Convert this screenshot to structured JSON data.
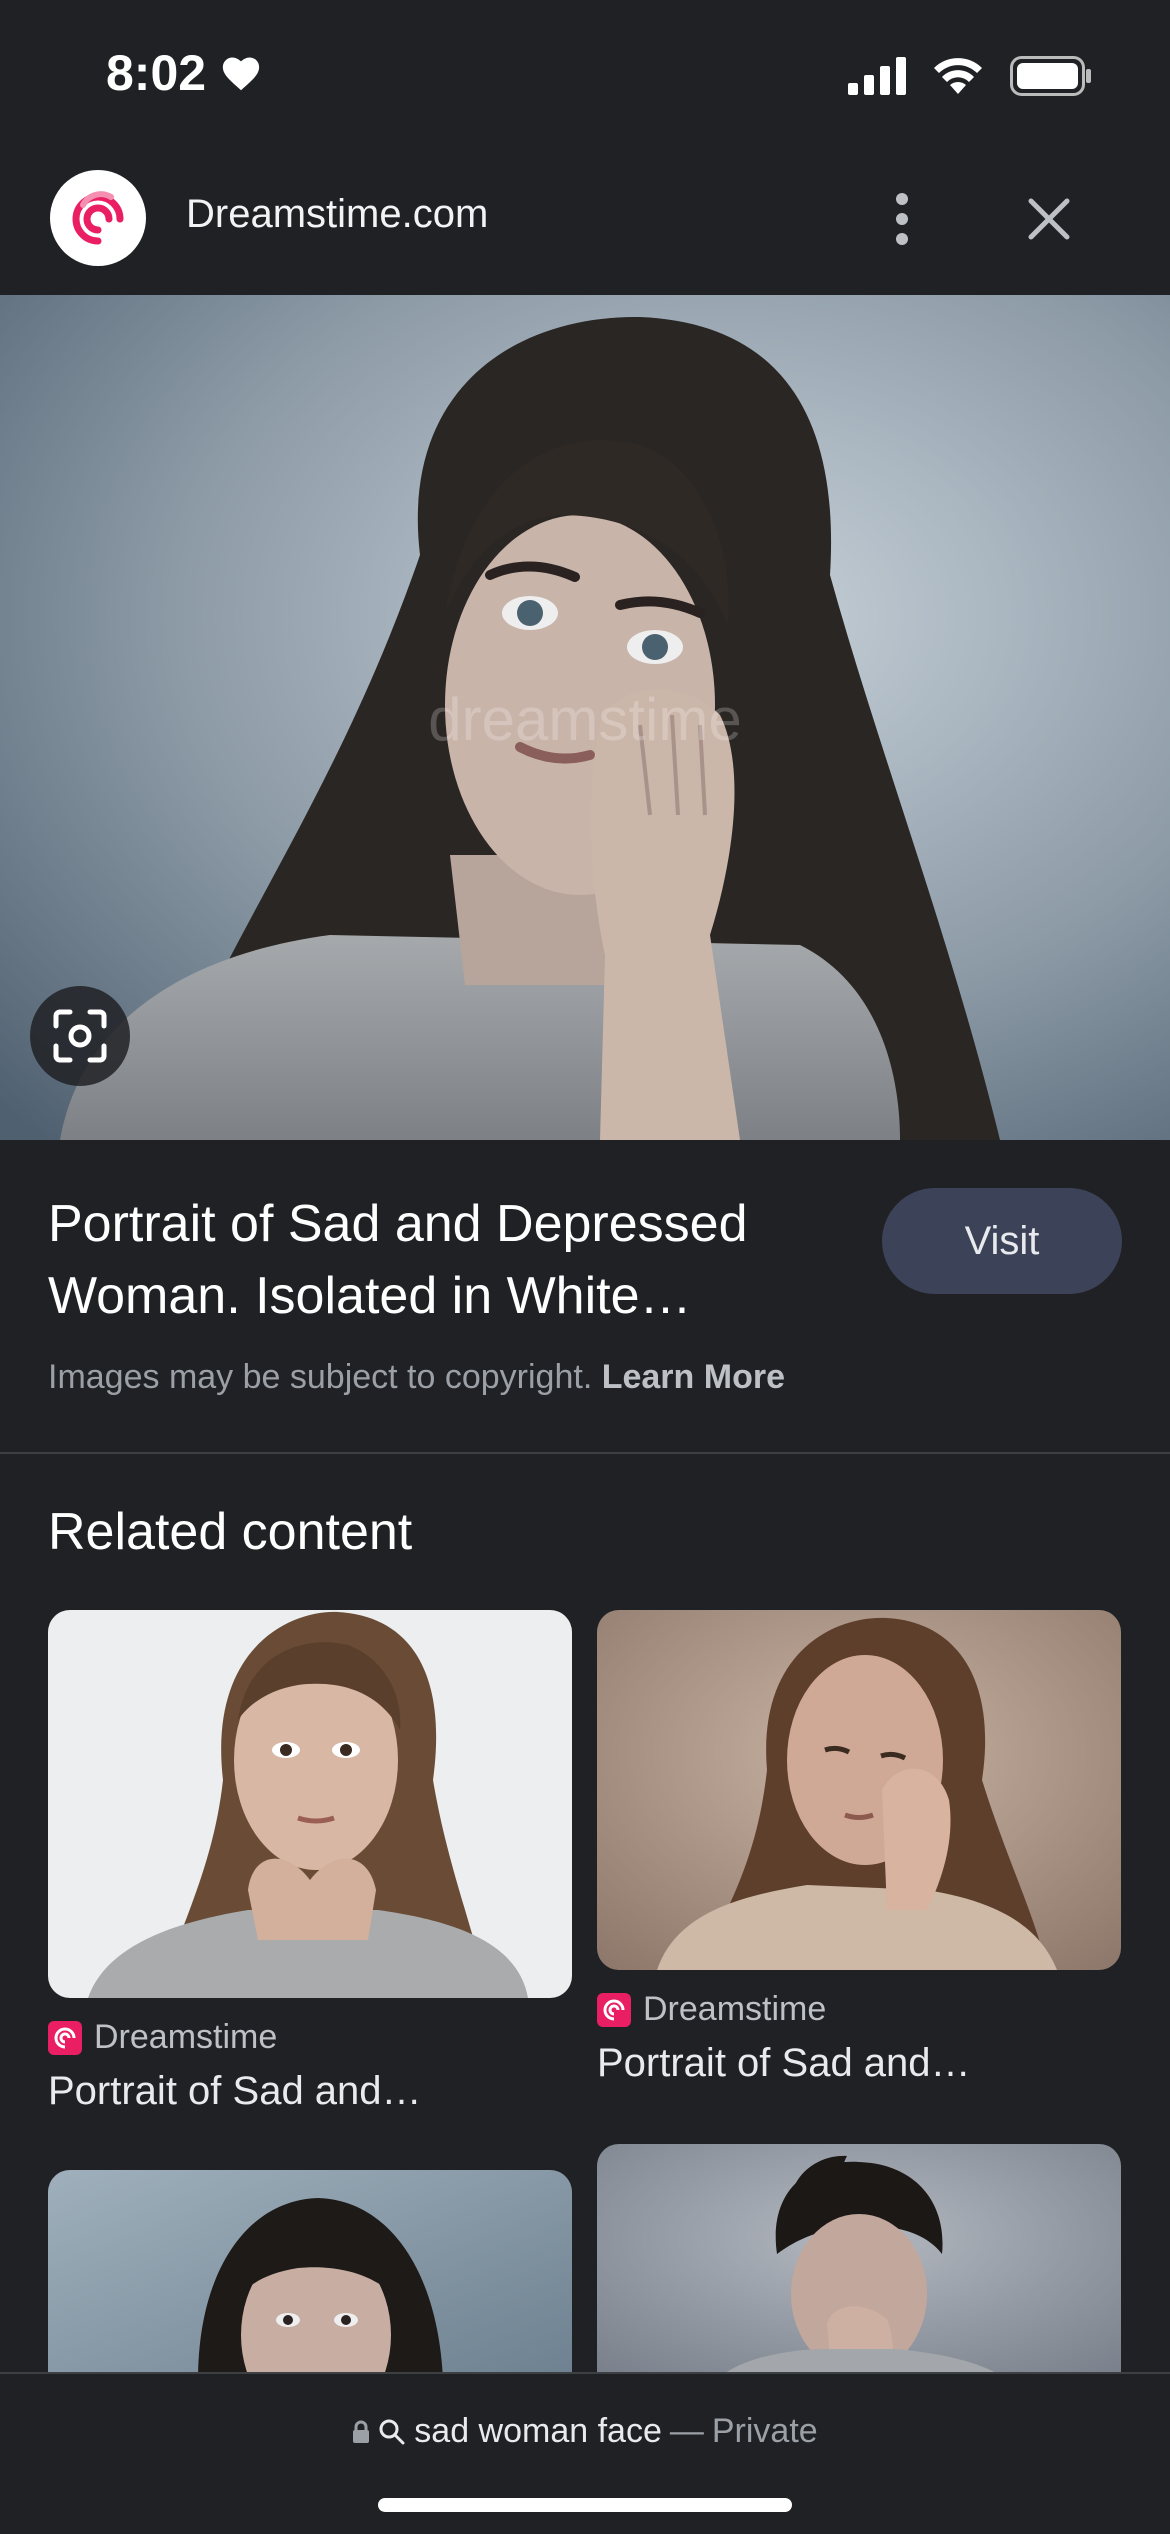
{
  "status": {
    "time": "8:02"
  },
  "header": {
    "site_name": "Dreamstime.com"
  },
  "result": {
    "title": "Portrait of Sad and Depressed Woman. Isolated in White…",
    "visit_label": "Visit",
    "copyright_text": "Images may be subject to copyright.",
    "learn_more_label": "Learn More"
  },
  "related": {
    "heading": "Related content",
    "cards": [
      {
        "source": "Dreamstime",
        "title": "Portrait of Sad and…"
      },
      {
        "source": "Dreamstime",
        "title": "Portrait of Sad and…"
      },
      {
        "source": "",
        "title": ""
      },
      {
        "source": "",
        "title": ""
      }
    ]
  },
  "bottom": {
    "query": "sad woman face",
    "separator": "—",
    "private_label": "Private"
  },
  "colors": {
    "background": "#202124",
    "visit_button": "#3c4257",
    "brand_pink": "#e91e63"
  }
}
